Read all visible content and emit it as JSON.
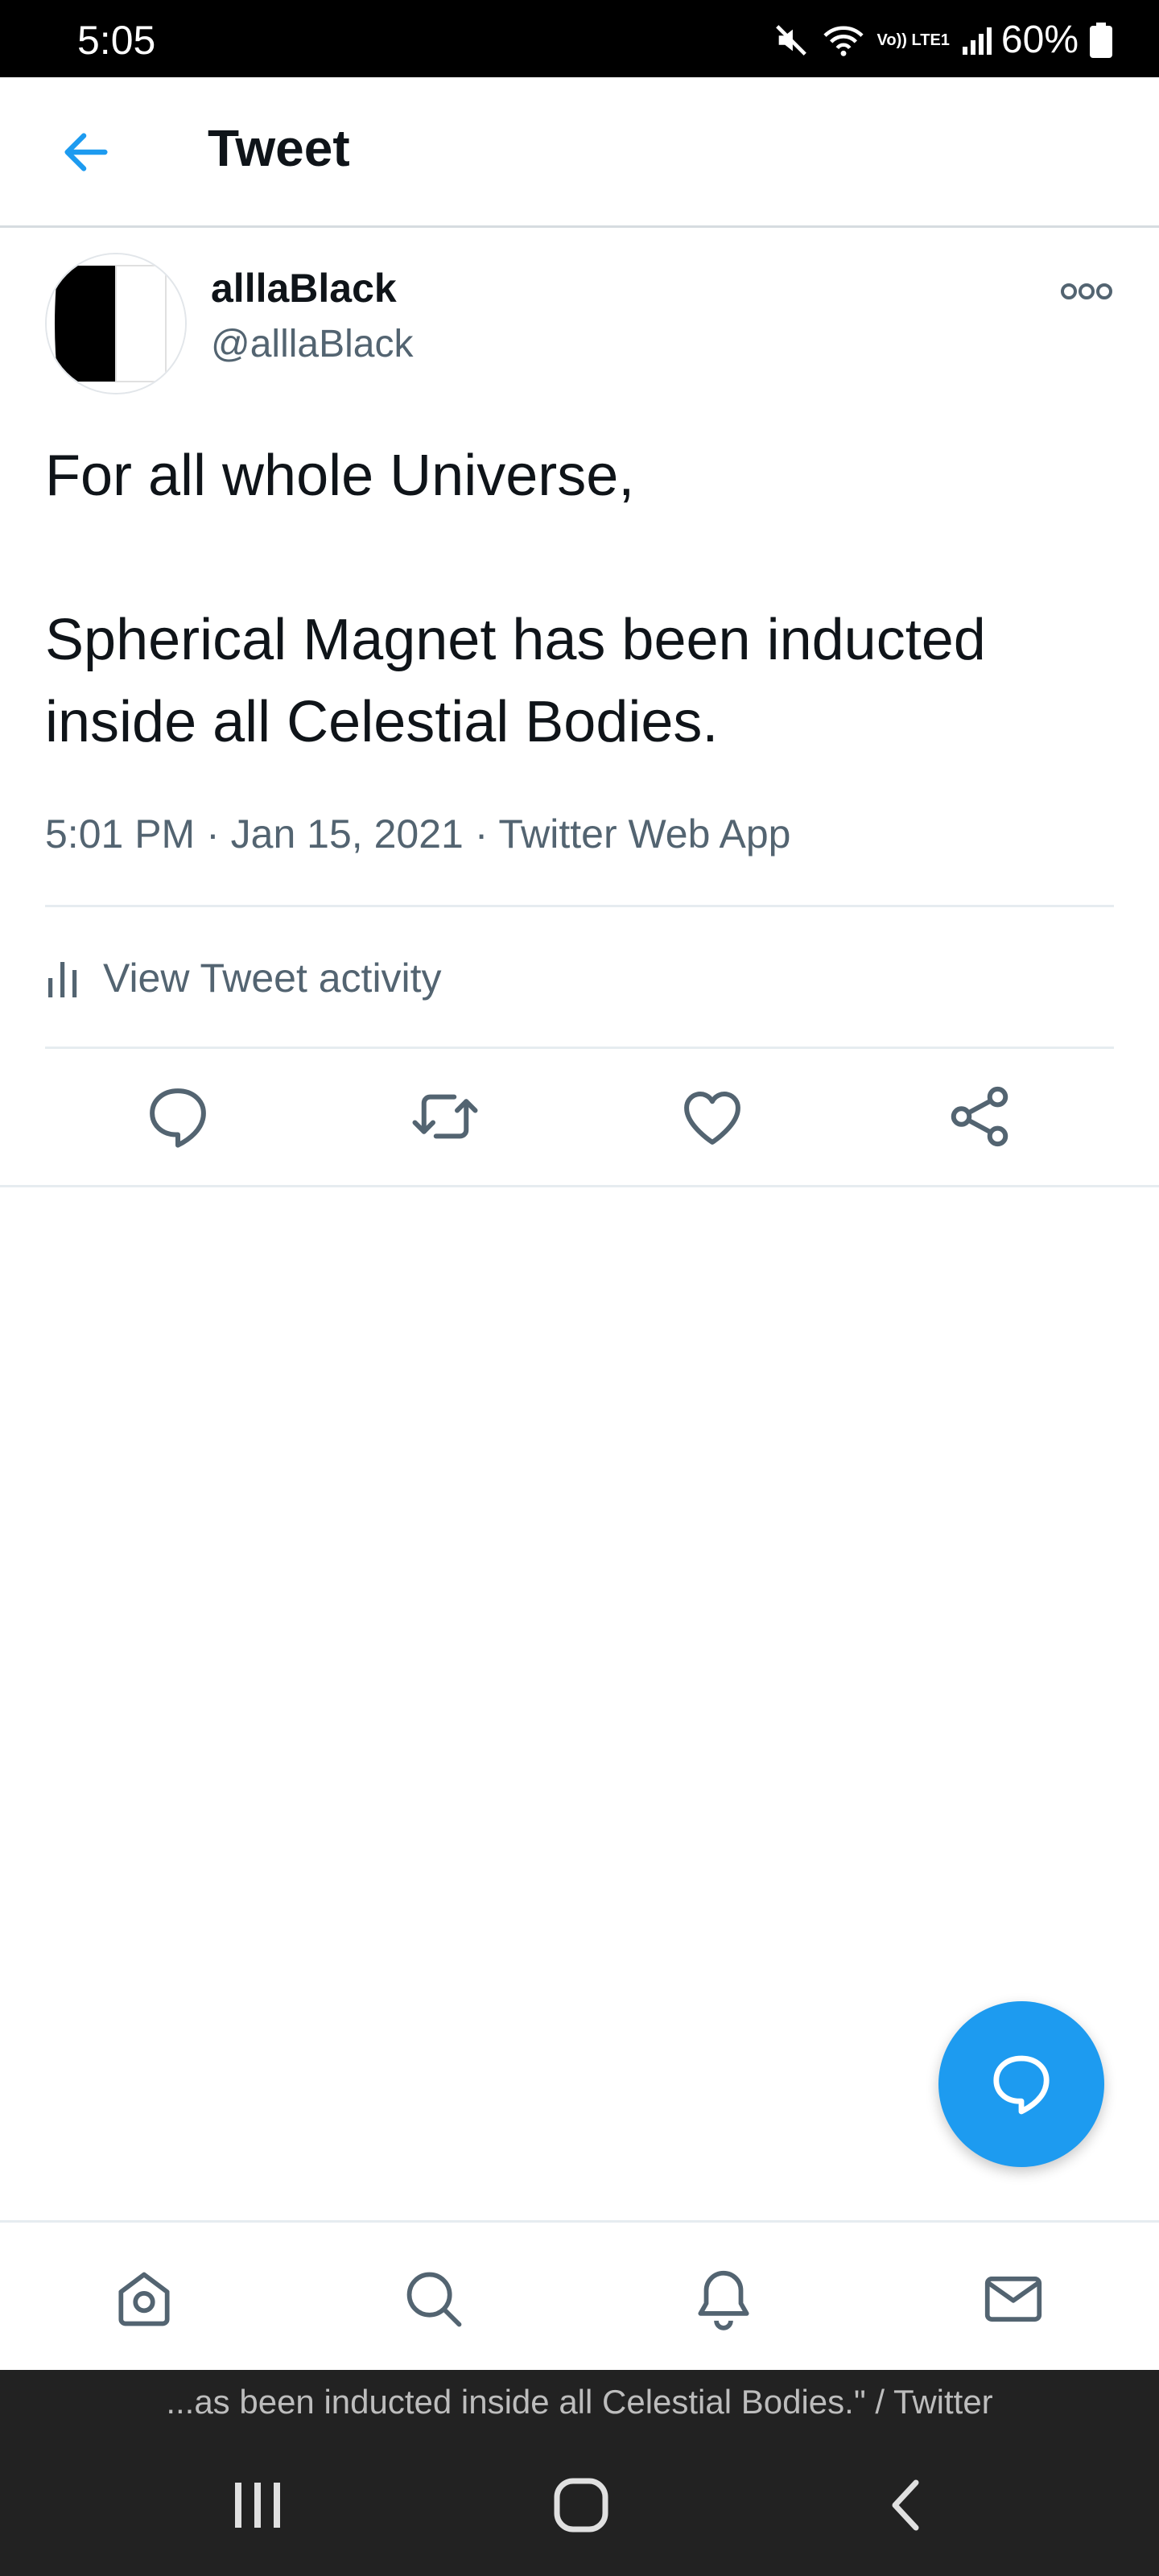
{
  "status_bar": {
    "time": "5:05",
    "network_label": "Vo)) LTE1",
    "battery": "60%"
  },
  "header": {
    "title": "Tweet",
    "back_icon": "arrow-left-icon"
  },
  "tweet": {
    "author_name": "alllaBlack",
    "author_handle": "@alllaBlack",
    "text_line1": "For all whole Universe,",
    "text_line2": "Spherical Magnet has been inducted inside all Celestial Bodies.",
    "time": "5:01 PM",
    "date": "Jan 15, 2021",
    "source": "Twitter Web App",
    "activity_label": "View Tweet activity"
  },
  "actions": [
    "reply-icon",
    "retweet-icon",
    "like-icon",
    "share-icon"
  ],
  "bottom_tabs": [
    "home-icon",
    "search-icon",
    "notifications-icon",
    "messages-icon"
  ],
  "browser_hint": "...as been inducted inside all Celestial Bodies.\" / Twitter",
  "colors": {
    "accent": "#1d9bf0",
    "text_primary": "#0f1419",
    "text_secondary": "#536471",
    "divider": "#e6ecf0"
  }
}
